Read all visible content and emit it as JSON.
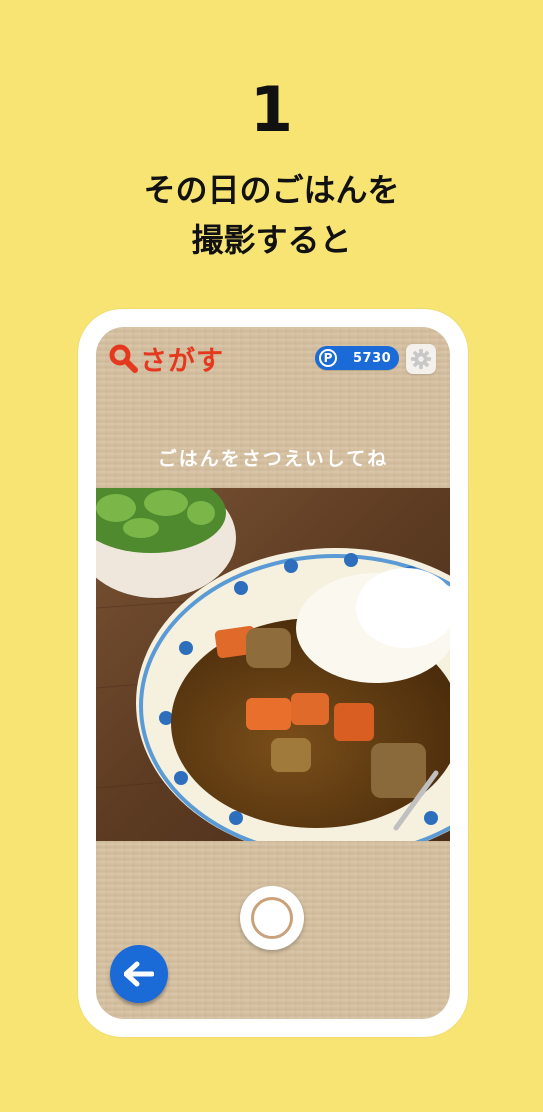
{
  "step": {
    "number": "1"
  },
  "headline": {
    "line1": "その日のごはんを",
    "line2": "撮影すると"
  },
  "app": {
    "logo_text": "さがす",
    "points": {
      "label": "P",
      "value": "5730"
    },
    "settings_icon": "gear-icon",
    "instruction": "ごはんをさつえいしてね",
    "photo_subject": "curry-rice-with-salad",
    "shutter_icon": "shutter-icon",
    "back_icon": "arrow-left-icon"
  },
  "colors": {
    "background": "#f8e473",
    "accent_red": "#e5391f",
    "accent_blue": "#1a6ad8",
    "cardboard": "#d6c0a0"
  }
}
